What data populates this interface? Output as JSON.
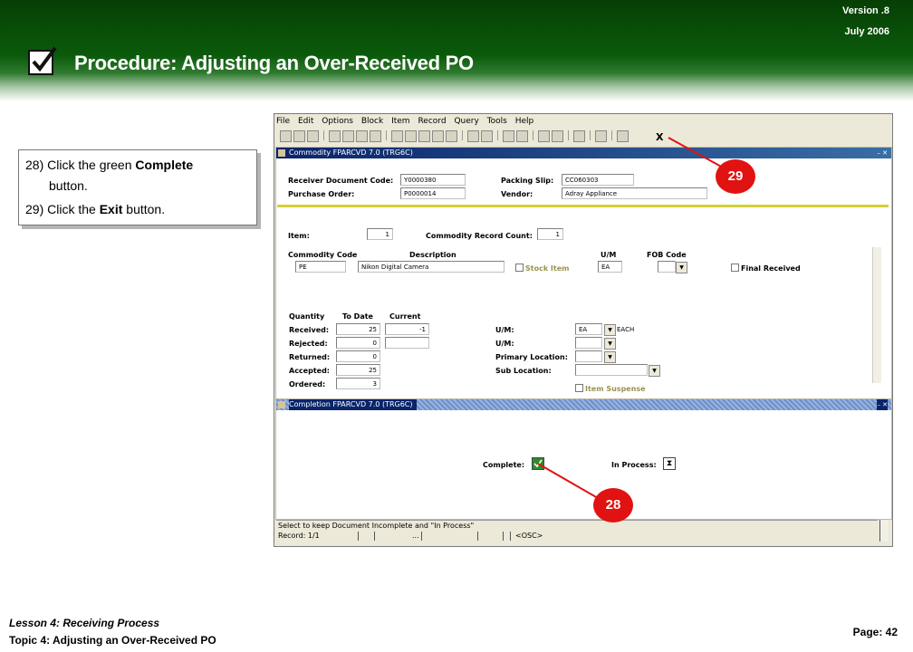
{
  "header": {
    "version": "Version .8",
    "date": "July 2006",
    "title": "Procedure:  Adjusting an Over-Received PO"
  },
  "instructions": {
    "step28_num": "28)",
    "step28_pre": "Click the green ",
    "step28_bold": "Complete",
    "step28_cont": "button.",
    "step29_num": "29)",
    "step29_pre": "Click the ",
    "step29_bold": "Exit",
    "step29_post": " button."
  },
  "app": {
    "menu": [
      "File",
      "Edit",
      "Options",
      "Block",
      "Item",
      "Record",
      "Query",
      "Tools",
      "Help"
    ],
    "exit_label": "X",
    "commodity_window_title": "Commodity  FPARCVD  7.0  (TRG6C)",
    "completion_window_title": "Completion  FPARCVD  7.0  (TRG6C)",
    "header_block": {
      "receiver_doc_label": "Receiver Document Code:",
      "receiver_doc_value": "Y0000380",
      "purchase_order_label": "Purchase Order:",
      "purchase_order_value": "P0000014",
      "packing_slip_label": "Packing Slip:",
      "packing_slip_value": "CC060303",
      "vendor_label": "Vendor:",
      "vendor_value": "Adray Appliance"
    },
    "item_block": {
      "item_label": "Item:",
      "item_value": "1",
      "count_label": "Commodity Record Count:",
      "count_value": "1",
      "commodity_code_label": "Commodity Code",
      "description_label": "Description",
      "um_label": "U/M",
      "fob_label": "FOB Code",
      "commodity_code_value": "PE",
      "description_value": "Nikon Digital Camera",
      "stock_item_label": "Stock Item",
      "um_value": "EA",
      "final_received_label": "Final Received"
    },
    "quantity_block": {
      "quantity_label": "Quantity",
      "to_date_label": "To Date",
      "current_label": "Current",
      "received_label": "Received:",
      "received_to_date": "25",
      "received_current": "-1",
      "rejected_label": "Rejected:",
      "rejected_to_date": "0",
      "returned_label": "Returned:",
      "returned_to_date": "0",
      "accepted_label": "Accepted:",
      "accepted_to_date": "25",
      "ordered_label": "Ordered:",
      "ordered_to_date": "3",
      "um1_label": "U/M:",
      "um1_value": "EA",
      "um1_desc": "EACH",
      "um2_label": "U/M:",
      "primary_location_label": "Primary Location:",
      "sub_location_label": "Sub Location:",
      "item_suspense_label": "Item  Suspense"
    },
    "completion": {
      "complete_label": "Complete:",
      "in_process_label": "In Process:"
    },
    "status": {
      "message": "Select to keep Document Incomplete and \"In Process\"",
      "record": "Record: 1/1",
      "ellipsis": "...",
      "osc": "<OSC>"
    }
  },
  "markers": {
    "m29": "29",
    "m28": "28"
  },
  "footer": {
    "lesson": "Lesson 4: Receiving Process",
    "topic": "Topic 4: Adjusting an Over-Received  PO",
    "page": "Page: 42"
  }
}
